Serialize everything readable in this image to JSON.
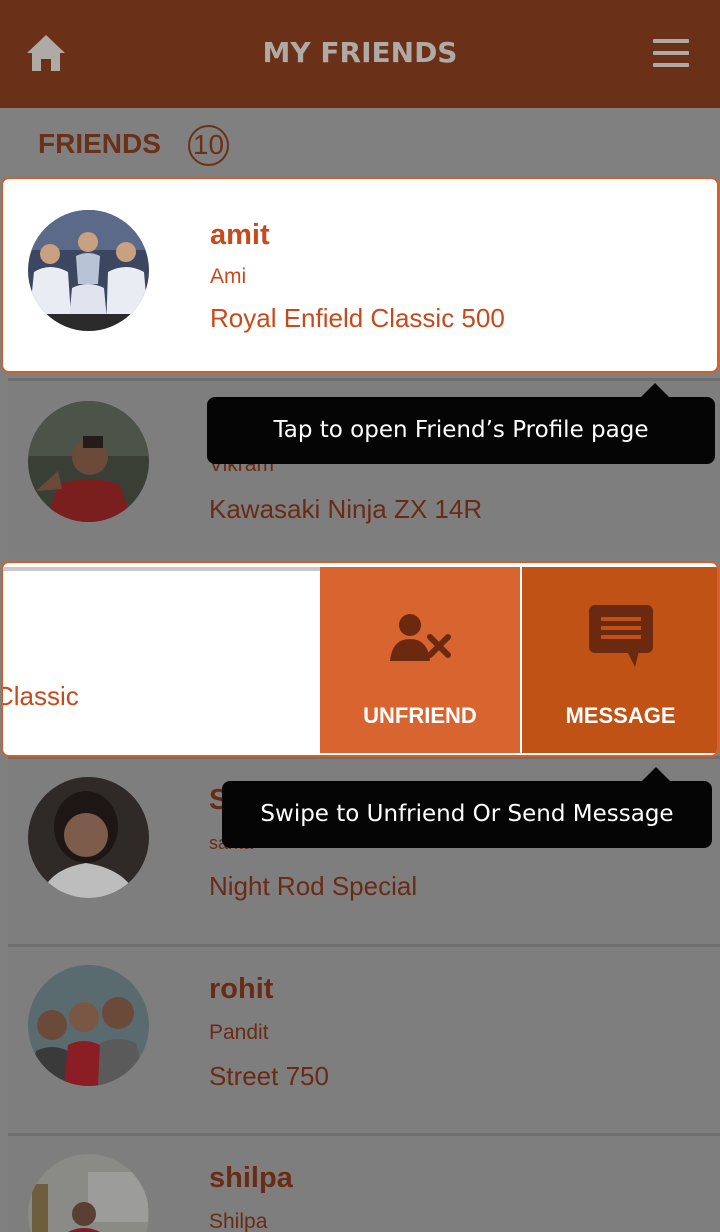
{
  "header": {
    "title": "MY FRIENDS"
  },
  "friends_section": {
    "label": "FRIENDS",
    "count": "10"
  },
  "friends": [
    {
      "name": "amit",
      "sub": "Ami",
      "bike": " Royal Enfield Classic 500"
    },
    {
      "name": "",
      "sub": "Vikram",
      "bike": " Kawasaki Ninja ZX 14R"
    },
    {
      "name": "S",
      "sub": "sarita",
      "bike": "Night Rod Special"
    },
    {
      "name": "rohit",
      "sub": "Pandit",
      "bike": "Street 750"
    },
    {
      "name": "shilpa",
      "sub": "Shilpa",
      "bike": ""
    }
  ],
  "swipe_row": {
    "partial_text": "Classic"
  },
  "actions": {
    "unfriend_label": "UNFRIEND",
    "message_label": "MESSAGE"
  },
  "tooltips": {
    "profile": "Tap to open Friend’s Profile page",
    "swipe": "Swipe to Unfriend Or Send Message"
  },
  "colors": {
    "header": "#6b3118",
    "accent": "#c74a1d",
    "unfriend": "#d8652f",
    "message": "#bf5214"
  }
}
